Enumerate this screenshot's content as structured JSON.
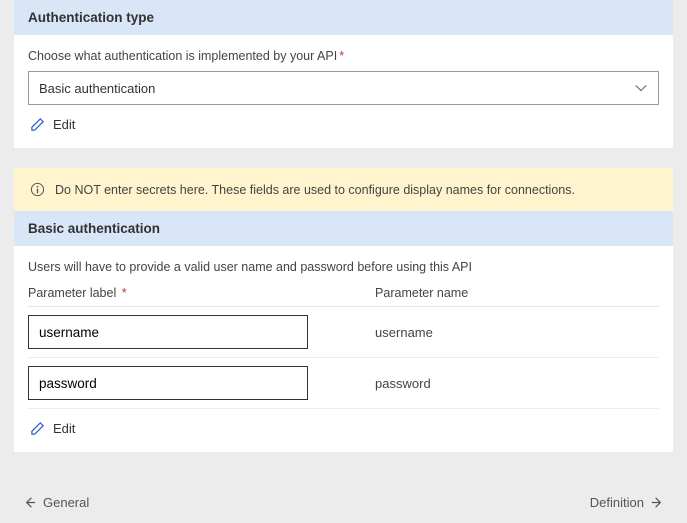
{
  "authSection": {
    "header": "Authentication type",
    "label": "Choose what authentication is implemented by your API",
    "selectValue": "Basic authentication",
    "editLabel": "Edit"
  },
  "warning": {
    "text": "Do NOT enter secrets here. These fields are used to configure display names for connections."
  },
  "basicAuth": {
    "header": "Basic authentication",
    "desc": "Users will have to provide a valid user name and password before using this API",
    "col1": "Parameter label",
    "col2": "Parameter name",
    "rows": [
      {
        "label": "username",
        "name": "username"
      },
      {
        "label": "password",
        "name": "password"
      }
    ],
    "editLabel": "Edit"
  },
  "footer": {
    "prev": "General",
    "next": "Definition"
  }
}
